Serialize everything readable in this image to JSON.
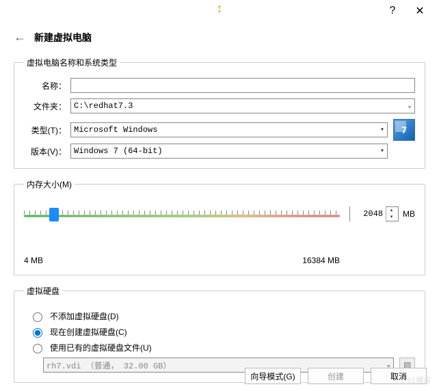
{
  "window": {
    "resize_cursor_glyph": "↕",
    "help_glyph": "?",
    "close_glyph": "✕"
  },
  "header": {
    "back_glyph": "←",
    "title": "新建虚拟电脑"
  },
  "group_name_type": {
    "legend": "虚拟电脑名称和系统类型",
    "name_label": "名称：",
    "name_value": "",
    "folder_label": "文件夹：",
    "folder_value": "C:\\redhat7.3",
    "type_label": "类型(T)：",
    "type_value": "Microsoft Windows",
    "version_label": "版本(V)：",
    "version_value": "Windows 7 (64-bit)",
    "os_icon_text": "7"
  },
  "group_memory": {
    "legend": "内存大小(M)",
    "min_label": "4 MB",
    "max_label": "16384 MB",
    "value": "2048",
    "unit": "MB",
    "slider_percent": 8
  },
  "group_disk": {
    "legend": "虚拟硬盘",
    "opt_none": "不添加虚拟硬盘(D)",
    "opt_create": "现在创建虚拟硬盘(C)",
    "opt_existing": "使用已有的虚拟硬盘文件(U)",
    "selected": "create",
    "file_display": "rh7.vdi （普通， 32.00 GB）"
  },
  "footer": {
    "guided": "向导模式(G)",
    "create": "创建",
    "cancel": "取消"
  },
  "watermark": "51博客"
}
